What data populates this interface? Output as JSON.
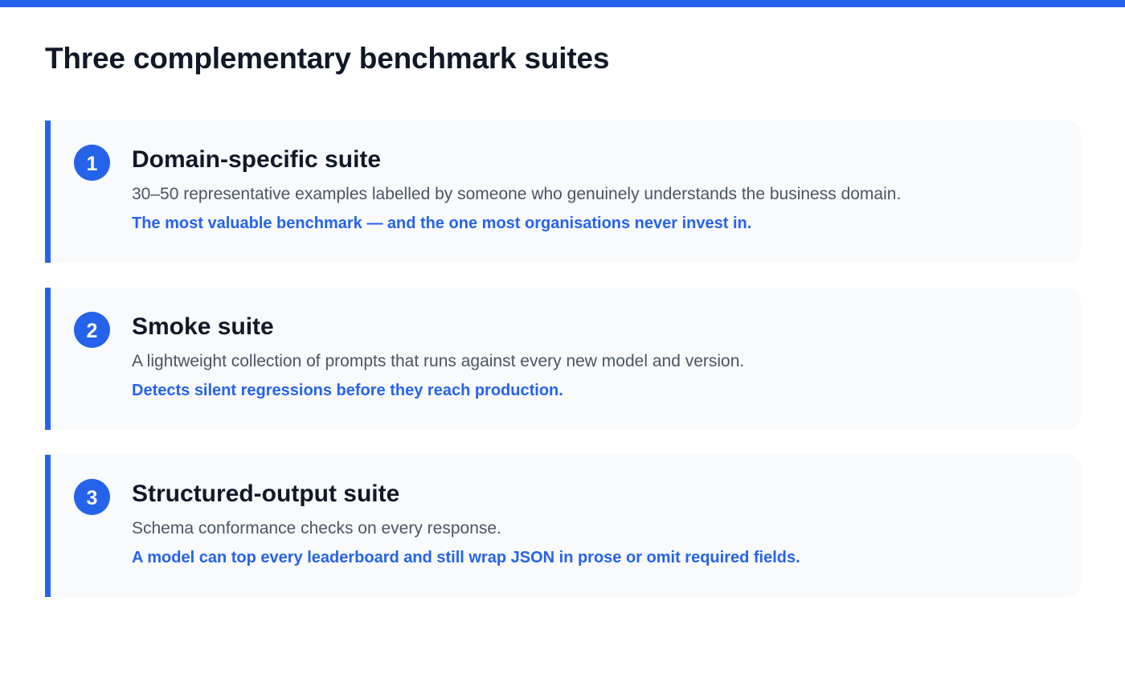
{
  "accent_color": "#2563eb",
  "title": "Three complementary benchmark suites",
  "suites": [
    {
      "number": "1",
      "title": "Domain-specific suite",
      "description": "30–50 representative examples labelled by someone who genuinely understands the business domain.",
      "highlight": "The most valuable benchmark — and the one most organisations never invest in."
    },
    {
      "number": "2",
      "title": "Smoke suite",
      "description": "A lightweight collection of prompts that runs against every new model and version.",
      "highlight": "Detects silent regressions before they reach production."
    },
    {
      "number": "3",
      "title": "Structured-output suite",
      "description": "Schema conformance checks on every response.",
      "highlight": "A model can top every leaderboard and still wrap JSON in prose or omit required fields."
    }
  ]
}
